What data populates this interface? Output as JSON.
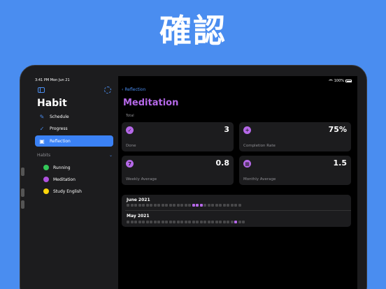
{
  "banner": {
    "title": "確認"
  },
  "status": {
    "time": "3:41 PM",
    "date": "Mon Jun 21",
    "battery": "100%"
  },
  "sidebar": {
    "app_title": "Habit",
    "nav": [
      {
        "label": "Schedule",
        "icon": "pencil-icon"
      },
      {
        "label": "Progress",
        "icon": "checkmark-icon"
      },
      {
        "label": "Reflection",
        "icon": "reflection-icon",
        "active": true
      }
    ],
    "section_title": "Habits",
    "habits": [
      {
        "label": "Running",
        "color": "#34c759"
      },
      {
        "label": "Meditation",
        "color": "#af52de"
      },
      {
        "label": "Study English",
        "color": "#ffd60a"
      }
    ]
  },
  "main": {
    "back_label": "Reflection",
    "title": "Meditation",
    "section_label": "Total",
    "stats": [
      {
        "label": "Done",
        "value": "3",
        "icon": "checkmark-circle-icon"
      },
      {
        "label": "Completion Rate",
        "value": "75%",
        "icon": "divide-circle-icon"
      },
      {
        "label": "Weekly Average",
        "value": "0.8",
        "icon": "seven-circle-icon"
      },
      {
        "label": "Monthly Average",
        "value": "1.5",
        "icon": "calendar-circle-icon"
      }
    ],
    "calendar": [
      {
        "month": "June 2021",
        "days": 30,
        "done": [
          18,
          19,
          20
        ]
      },
      {
        "month": "May 2021",
        "days": 31,
        "done": [
          29
        ]
      }
    ]
  },
  "colors": {
    "accent": "#4a8df0",
    "habit_purple": "#b568e8",
    "background": "#4a8df0"
  }
}
